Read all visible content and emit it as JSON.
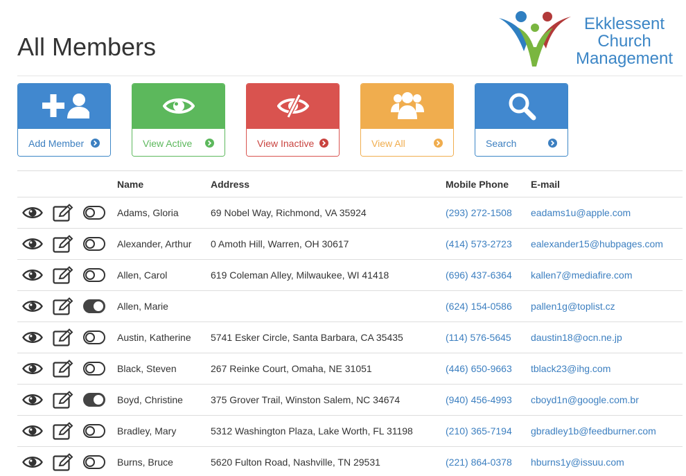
{
  "header": {
    "title": "All Members",
    "logo_lines": [
      "Ekklessent",
      "Church",
      "Management"
    ]
  },
  "colors": {
    "primary": "#4188cf",
    "success": "#5cb85c",
    "danger": "#d9534f",
    "warning": "#f0ad4e",
    "link": "#3c7fc0"
  },
  "tiles": [
    {
      "label": "Add Member",
      "icon": "add-user-icon",
      "color": "blue"
    },
    {
      "label": "View Active",
      "icon": "eye-icon",
      "color": "green"
    },
    {
      "label": "View Inactive",
      "icon": "eye-slash-icon",
      "color": "red"
    },
    {
      "label": "View All",
      "icon": "users-icon",
      "color": "orange"
    },
    {
      "label": "Search",
      "icon": "search-icon",
      "color": "blue"
    }
  ],
  "table": {
    "columns": [
      "",
      "Name",
      "Address",
      "Mobile Phone",
      "E-mail"
    ],
    "rows": [
      {
        "name": "Adams, Gloria",
        "address": "69 Nobel Way, Richmond, VA 35924",
        "phone": "(293) 272-1508",
        "email": "eadams1u@apple.com",
        "inactive": false
      },
      {
        "name": "Alexander, Arthur",
        "address": "0 Amoth Hill, Warren, OH 30617",
        "phone": "(414) 573-2723",
        "email": "ealexander15@hubpages.com",
        "inactive": false
      },
      {
        "name": "Allen, Carol",
        "address": "619 Coleman Alley, Milwaukee, WI 41418",
        "phone": "(696) 437-6364",
        "email": "kallen7@mediafire.com",
        "inactive": false
      },
      {
        "name": "Allen, Marie",
        "address": "",
        "phone": "(624) 154-0586",
        "email": "pallen1g@toplist.cz",
        "inactive": true
      },
      {
        "name": "Austin, Katherine",
        "address": "5741 Esker Circle, Santa Barbara, CA 35435",
        "phone": "(114) 576-5645",
        "email": "daustin18@ocn.ne.jp",
        "inactive": false
      },
      {
        "name": "Black, Steven",
        "address": "267 Reinke Court, Omaha, NE 31051",
        "phone": "(446) 650-9663",
        "email": "tblack23@ihg.com",
        "inactive": false
      },
      {
        "name": "Boyd, Christine",
        "address": "375 Grover Trail, Winston Salem, NC 34674",
        "phone": "(940) 456-4993",
        "email": "cboyd1n@google.com.br",
        "inactive": true
      },
      {
        "name": "Bradley, Mary",
        "address": "5312 Washington Plaza, Lake Worth, FL 31198",
        "phone": "(210) 365-7194",
        "email": "gbradley1b@feedburner.com",
        "inactive": false
      },
      {
        "name": "Burns, Bruce",
        "address": "5620 Fulton Road, Nashville, TN 29531",
        "phone": "(221) 864-0378",
        "email": "hburns1y@issuu.com",
        "inactive": false
      }
    ]
  }
}
